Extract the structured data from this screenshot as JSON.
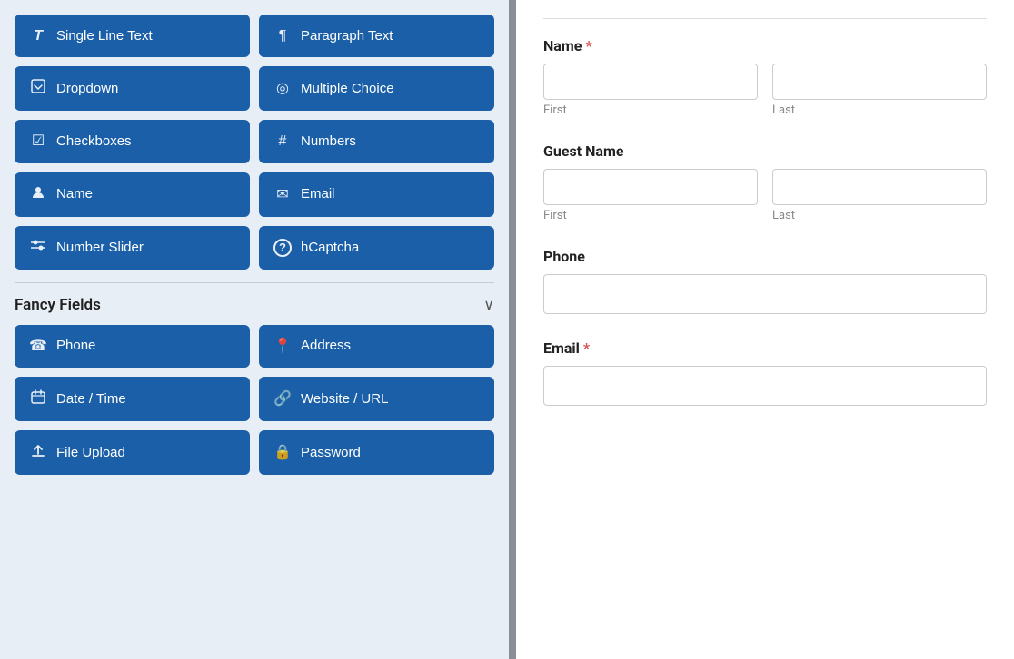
{
  "left_panel": {
    "basic_fields": [
      {
        "id": "single-line-text",
        "label": "Single Line Text",
        "icon": "T̲"
      },
      {
        "id": "paragraph-text",
        "label": "Paragraph Text",
        "icon": "¶"
      },
      {
        "id": "dropdown",
        "label": "Dropdown",
        "icon": "⊟"
      },
      {
        "id": "multiple-choice",
        "label": "Multiple Choice",
        "icon": "◎"
      },
      {
        "id": "checkboxes",
        "label": "Checkboxes",
        "icon": "☑"
      },
      {
        "id": "numbers",
        "label": "Numbers",
        "icon": "#"
      },
      {
        "id": "name",
        "label": "Name",
        "icon": "👤"
      },
      {
        "id": "email",
        "label": "Email",
        "icon": "✉"
      },
      {
        "id": "number-slider",
        "label": "Number Slider",
        "icon": "⇌"
      },
      {
        "id": "hcaptcha",
        "label": "hCaptcha",
        "icon": "?"
      }
    ],
    "fancy_fields_title": "Fancy Fields",
    "fancy_fields": [
      {
        "id": "phone",
        "label": "Phone",
        "icon": "☎"
      },
      {
        "id": "address",
        "label": "Address",
        "icon": "📍"
      },
      {
        "id": "date-time",
        "label": "Date / Time",
        "icon": "📅"
      },
      {
        "id": "website-url",
        "label": "Website / URL",
        "icon": "🔗"
      },
      {
        "id": "file-upload",
        "label": "File Upload",
        "icon": "⬆"
      },
      {
        "id": "password",
        "label": "Password",
        "icon": "🔒"
      }
    ]
  },
  "right_panel": {
    "form_fields": [
      {
        "id": "name-field",
        "label": "Name",
        "required": true,
        "type": "name",
        "subfields": [
          "First",
          "Last"
        ]
      },
      {
        "id": "guest-name-field",
        "label": "Guest Name",
        "required": false,
        "type": "name",
        "subfields": [
          "First",
          "Last"
        ]
      },
      {
        "id": "phone-field",
        "label": "Phone",
        "required": false,
        "type": "phone"
      },
      {
        "id": "email-field",
        "label": "Email",
        "required": true,
        "type": "email"
      }
    ]
  }
}
